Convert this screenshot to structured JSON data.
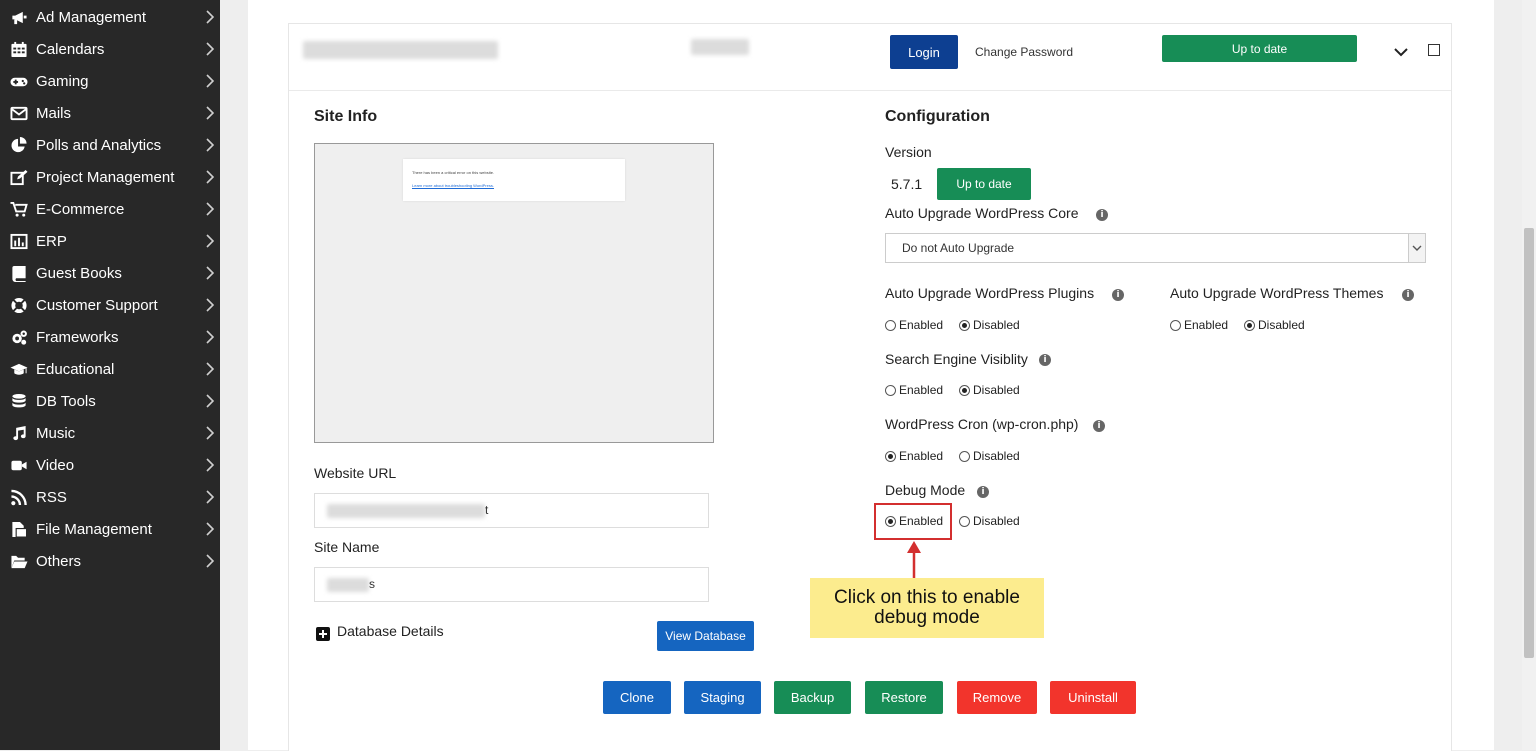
{
  "sidebar": {
    "items": [
      {
        "label": "Ad Management",
        "icon": "megaphone-icon"
      },
      {
        "label": "Calendars",
        "icon": "calendar-icon"
      },
      {
        "label": "Gaming",
        "icon": "gamepad-icon"
      },
      {
        "label": "Mails",
        "icon": "envelope-icon"
      },
      {
        "label": "Polls and Analytics",
        "icon": "pie-chart-icon"
      },
      {
        "label": "Project Management",
        "icon": "edit-icon"
      },
      {
        "label": "E-Commerce",
        "icon": "cart-icon"
      },
      {
        "label": "ERP",
        "icon": "bar-chart-icon"
      },
      {
        "label": "Guest Books",
        "icon": "book-icon"
      },
      {
        "label": "Customer Support",
        "icon": "lifebuoy-icon"
      },
      {
        "label": "Frameworks",
        "icon": "cogs-icon"
      },
      {
        "label": "Educational",
        "icon": "graduation-cap-icon"
      },
      {
        "label": "DB Tools",
        "icon": "database-icon"
      },
      {
        "label": "Music",
        "icon": "music-icon"
      },
      {
        "label": "Video",
        "icon": "video-camera-icon"
      },
      {
        "label": "RSS",
        "icon": "rss-icon"
      },
      {
        "label": "File Management",
        "icon": "file-icon"
      },
      {
        "label": "Others",
        "icon": "folder-open-icon"
      }
    ]
  },
  "topbar": {
    "login_label": "Login",
    "change_password_label": "Change Password",
    "status_label": "Up to date"
  },
  "site_info": {
    "heading": "Site Info",
    "screenshot_line1": "There has been a critical error on this website.",
    "screenshot_line2": "Learn more about troubleshooting WordPress.",
    "website_url_label": "Website URL",
    "website_url_suffix": "t",
    "site_name_label": "Site Name",
    "site_name_suffix": "s",
    "database_details_label": "Database Details",
    "view_database_label": "View Database"
  },
  "configuration": {
    "heading": "Configuration",
    "version_label": "Version",
    "version_value": "5.7.1",
    "version_status": "Up to date",
    "core_label": "Auto Upgrade WordPress Core",
    "core_selected": "Do not Auto Upgrade",
    "plugins_label": "Auto Upgrade WordPress Plugins",
    "themes_label": "Auto Upgrade WordPress Themes",
    "search_label": "Search Engine Visiblity",
    "cron_label": "WordPress Cron (wp-cron.php)",
    "debug_label": "Debug Mode",
    "enabled": "Enabled",
    "disabled": "Disabled"
  },
  "callout": {
    "text_line1": "Click on this to enable",
    "text_line2": "debug mode"
  },
  "actions": {
    "clone": "Clone",
    "staging": "Staging",
    "backup": "Backup",
    "restore": "Restore",
    "remove": "Remove",
    "uninstall": "Uninstall"
  },
  "colors": {
    "sidebar_bg": "#282828",
    "primary_blue": "#1565c0",
    "login_blue": "#0d3f91",
    "success_green": "#178d56",
    "danger_red": "#f2342c",
    "highlight_red": "#d32f2f",
    "callout_yellow": "#fcec8e"
  }
}
